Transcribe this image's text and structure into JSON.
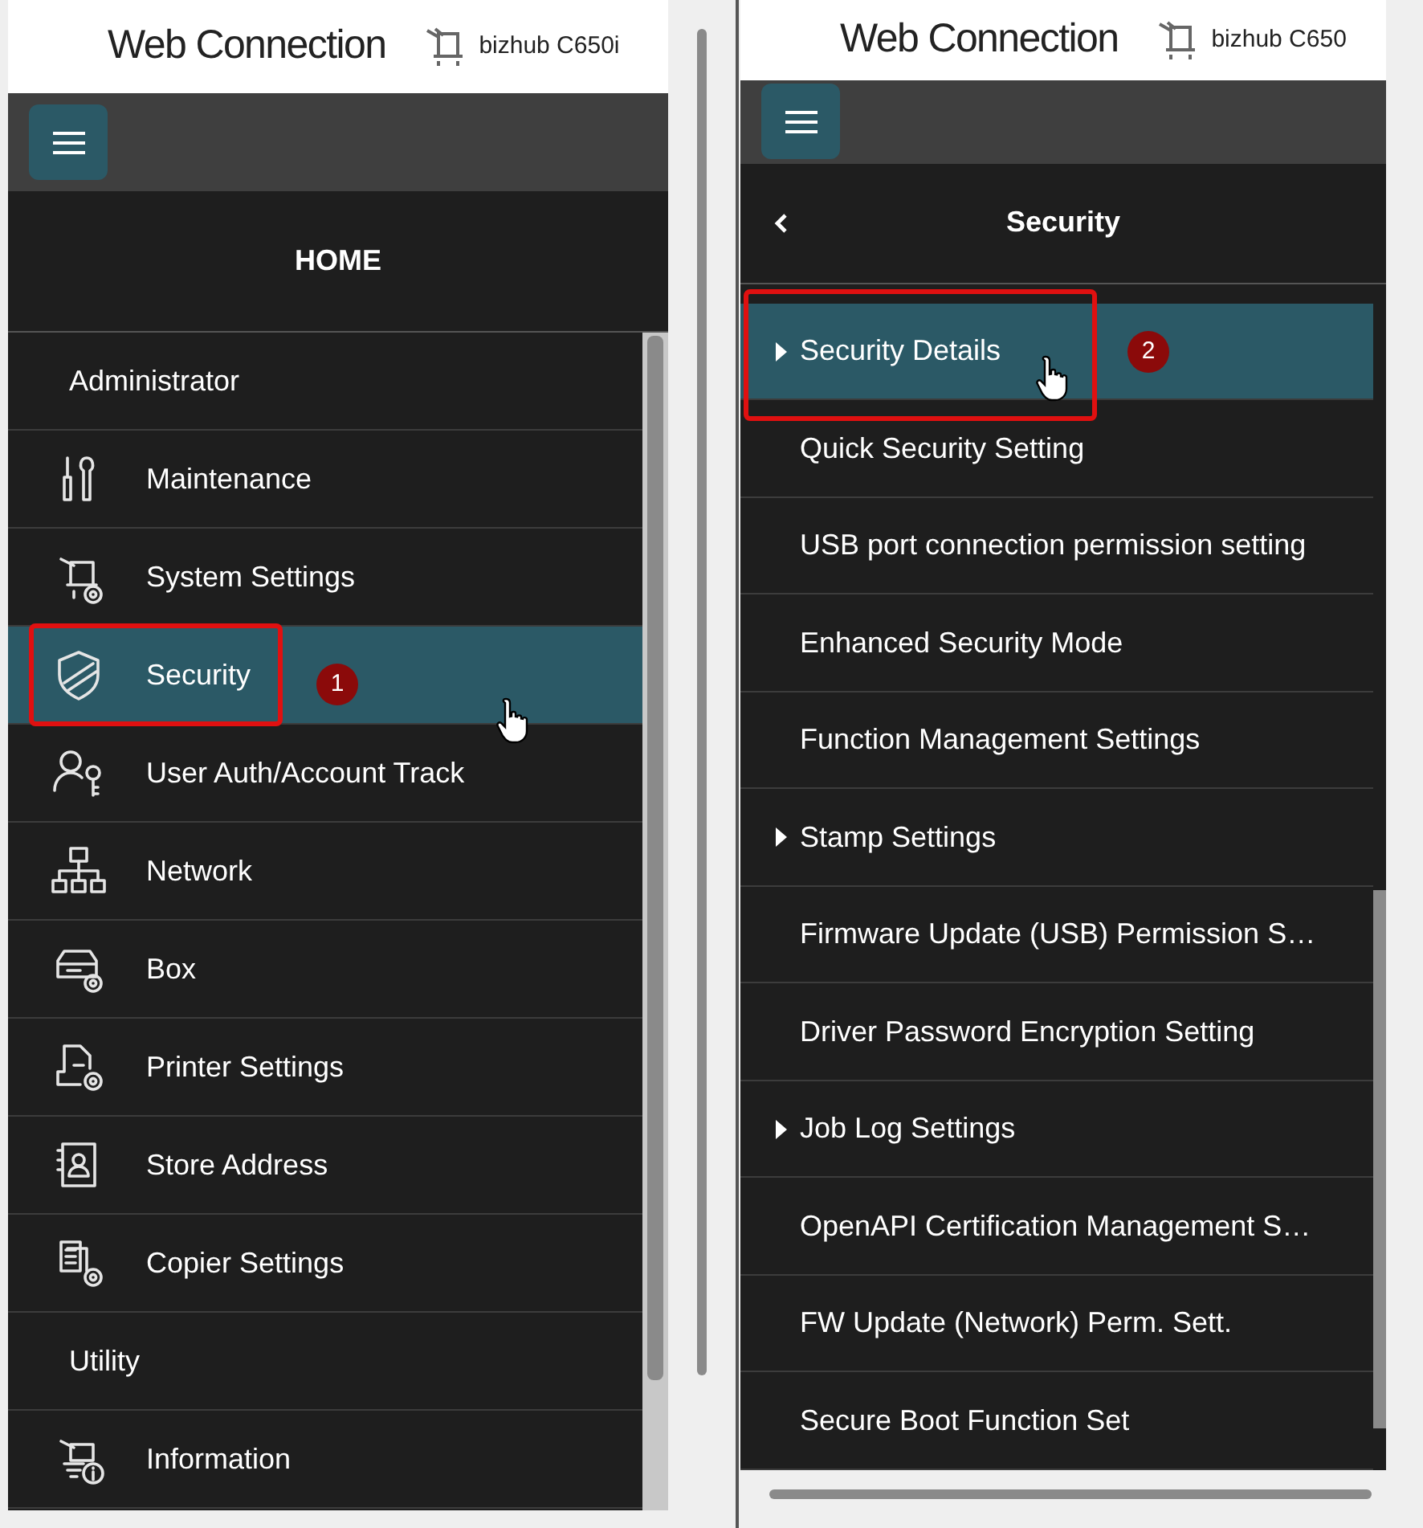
{
  "panels": [
    {
      "header": {
        "logo": "Web Connection",
        "device": "bizhub C650i"
      },
      "title": "HOME",
      "back": false,
      "items": [
        {
          "kind": "section",
          "label": "Administrator",
          "selected": false
        },
        {
          "kind": "item",
          "label": "Maintenance",
          "selected": false
        },
        {
          "kind": "item",
          "label": "System Settings",
          "selected": false
        },
        {
          "kind": "item",
          "label": "Security",
          "selected": true,
          "badge": "1"
        },
        {
          "kind": "item",
          "label": "User Auth/Account Track",
          "selected": false
        },
        {
          "kind": "item",
          "label": "Network",
          "selected": false
        },
        {
          "kind": "item",
          "label": "Box",
          "selected": false
        },
        {
          "kind": "item",
          "label": "Printer Settings",
          "selected": false
        },
        {
          "kind": "item",
          "label": "Store Address",
          "selected": false
        },
        {
          "kind": "item",
          "label": "Copier Settings",
          "selected": false
        },
        {
          "kind": "section",
          "label": "Utility",
          "selected": false
        },
        {
          "kind": "item",
          "label": "Information",
          "selected": false
        }
      ]
    },
    {
      "header": {
        "logo": "Web Connection",
        "device": "bizhub C650"
      },
      "title": "Security",
      "back": true,
      "items": [
        {
          "kind": "sub",
          "label": "Security Details",
          "expandable": true,
          "selected": true,
          "badge": "2"
        },
        {
          "kind": "sub",
          "label": "Quick Security Setting",
          "expandable": false,
          "selected": false
        },
        {
          "kind": "sub",
          "label": "USB port connection permission setting",
          "expandable": false,
          "selected": false
        },
        {
          "kind": "sub",
          "label": "Enhanced Security Mode",
          "expandable": false,
          "selected": false
        },
        {
          "kind": "sub",
          "label": "Function Management Settings",
          "expandable": false,
          "selected": false
        },
        {
          "kind": "sub",
          "label": "Stamp Settings",
          "expandable": true,
          "selected": false
        },
        {
          "kind": "sub",
          "label": "Firmware Update (USB) Permission S…",
          "expandable": false,
          "selected": false
        },
        {
          "kind": "sub",
          "label": "Driver Password Encryption Setting",
          "expandable": false,
          "selected": false
        },
        {
          "kind": "sub",
          "label": "Job Log Settings",
          "expandable": true,
          "selected": false
        },
        {
          "kind": "sub",
          "label": "OpenAPI Certification Management S…",
          "expandable": false,
          "selected": false
        },
        {
          "kind": "sub",
          "label": "FW Update (Network) Perm. Sett.",
          "expandable": false,
          "selected": false
        },
        {
          "kind": "sub",
          "label": "Secure Boot Function Set",
          "expandable": false,
          "selected": false
        }
      ]
    }
  ]
}
